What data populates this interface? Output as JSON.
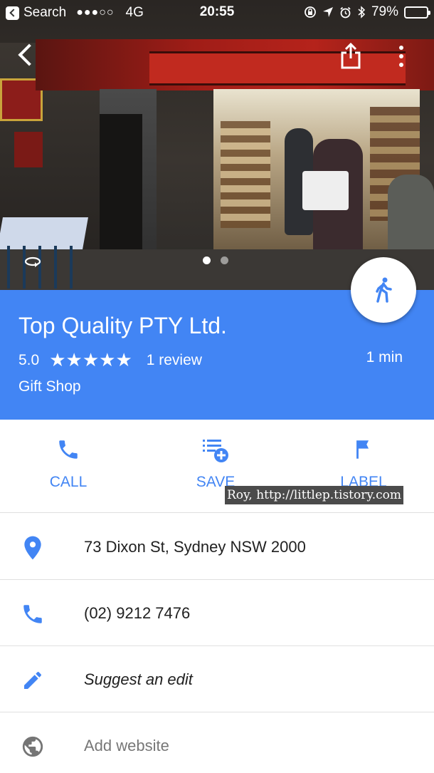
{
  "status_bar": {
    "back_app": "Search",
    "signal": "●●●○○",
    "network": "4G",
    "time": "20:55",
    "battery": "79%",
    "battery_level": 0.79
  },
  "place": {
    "name": "Top Quality PTY Ltd.",
    "rating": "5.0",
    "stars": "★★★★★",
    "reviews": "1 review",
    "category": "Gift Shop",
    "eta": "1 min"
  },
  "actions": {
    "call": "CALL",
    "save": "SAVE",
    "label": "LABEL"
  },
  "details": {
    "address": "73 Dixon St, Sydney NSW 2000",
    "phone": "(02) 9212 7476",
    "suggest_edit": "Suggest an edit",
    "add_website": "Add website"
  },
  "watermark": "Roy, http://littlep.tistory.com",
  "photo": {
    "page_count": 2,
    "active_page": 1
  },
  "colors": {
    "accent": "#4285f4",
    "icon_gray": "#757575"
  },
  "icons": {
    "back": "chevron-left-icon",
    "share": "share-icon",
    "more": "more-vert-icon",
    "rotate": "360-rotate-icon",
    "walk": "walking-person-icon",
    "call": "phone-icon",
    "save": "playlist-add-icon",
    "label": "flag-icon",
    "address": "location-pin-icon",
    "phone": "phone-icon",
    "edit": "pencil-icon",
    "website": "globe-icon"
  }
}
